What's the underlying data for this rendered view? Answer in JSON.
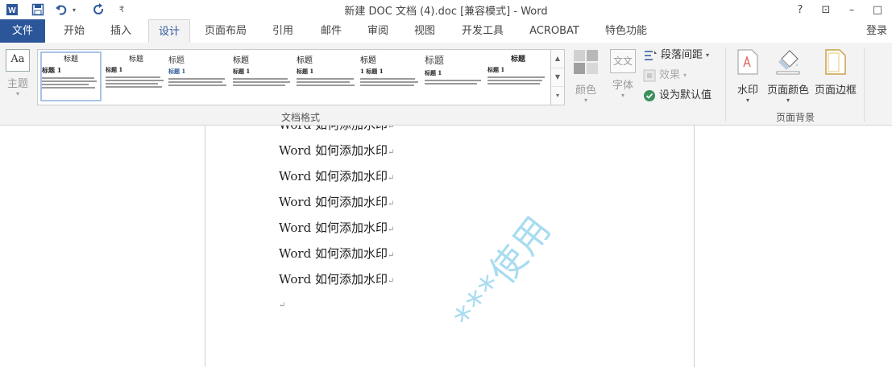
{
  "window": {
    "title": "新建 DOC 文档 (4).doc [兼容模式] - Word",
    "help": "?",
    "ribbon_display": "⊡",
    "minimize": "–",
    "maximize": "□"
  },
  "tabs": [
    "文件",
    "开始",
    "插入",
    "设计",
    "页面布局",
    "引用",
    "邮件",
    "审阅",
    "视图",
    "开发工具",
    "ACROBAT",
    "特色功能"
  ],
  "active_tab": "设计",
  "login": "登录",
  "ribbon": {
    "theme_label": "主题",
    "theme_icon_text": "Aa",
    "styles": [
      {
        "title": "标题",
        "heading": "标题 1"
      },
      {
        "title": "标题",
        "heading": "标题 1"
      },
      {
        "title": "标题",
        "heading": "标题 1"
      },
      {
        "title": "标题",
        "heading": "标题 1"
      },
      {
        "title": "标题",
        "heading": "标题 1"
      },
      {
        "title": "标题",
        "heading": "1 标题 1"
      },
      {
        "title": "标题",
        "heading": "标题 1"
      },
      {
        "title": "标题",
        "heading": "标题 1"
      }
    ],
    "gallery_group_label": "文档格式",
    "colors_label": "颜色",
    "fonts_label": "字体",
    "fonts_icon_text": "文文",
    "paragraph_spacing": "段落间距",
    "effects": "效果",
    "set_default": "设为默认值",
    "watermark_label": "水印",
    "page_color_label": "页面颜色",
    "page_borders_label": "页面边框",
    "page_bg_group_label": "页面背景"
  },
  "document": {
    "lines": [
      "Word 如何添加水印",
      "Word 如何添加水印",
      "Word 如何添加水印",
      "Word 如何添加水印",
      "Word 如何添加水印",
      "Word 如何添加水印",
      "Word 如何添加水印"
    ],
    "paragraph_mark": "↵",
    "watermark_text": "***使用"
  },
  "colors": {
    "accent": "#2b579a",
    "watermark": "#a8dcf0"
  }
}
